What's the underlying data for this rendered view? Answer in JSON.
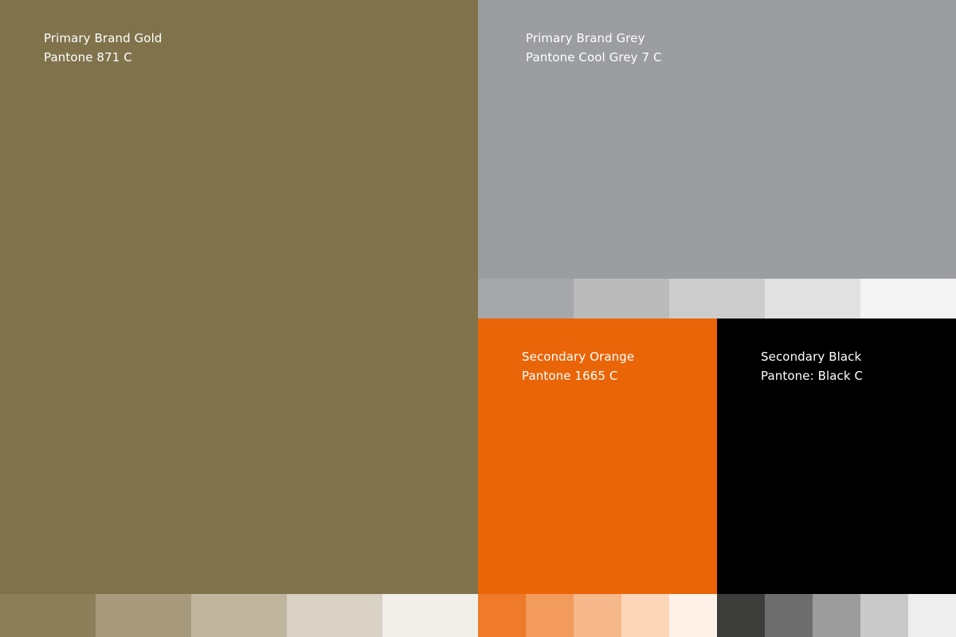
{
  "swatches": {
    "gold": {
      "name": "Primary Brand Gold",
      "pantone": "Pantone 871 C",
      "color": "#80734c",
      "tints": [
        "#8b7f59",
        "#a79a7c",
        "#c0b59f",
        "#d9d2c5",
        "#f1efea"
      ]
    },
    "grey": {
      "name": "Primary Brand Grey",
      "pantone": "Pantone Cool Grey 7 C",
      "color": "#9c9da1",
      "tints": [
        "#a6a7aa",
        "#bbbbbc",
        "#cccccd",
        "#e1e1e1",
        "#f4f4f4"
      ]
    },
    "orange": {
      "name": "Secondary Orange",
      "pantone": "Pantone 1665 C",
      "color": "#ea6507",
      "tints": [
        "#ee7a2a",
        "#f29b5c",
        "#f7b88b",
        "#fcd6b9",
        "#fdf1e8"
      ]
    },
    "black": {
      "name": "Secondary Black",
      "pantone": "Pantone:  Black C",
      "color": "#000000",
      "tints": [
        "#3c3c3b",
        "#6d6d6d",
        "#9c9c9c",
        "#c9c9c9",
        "#eeeeee"
      ]
    }
  }
}
